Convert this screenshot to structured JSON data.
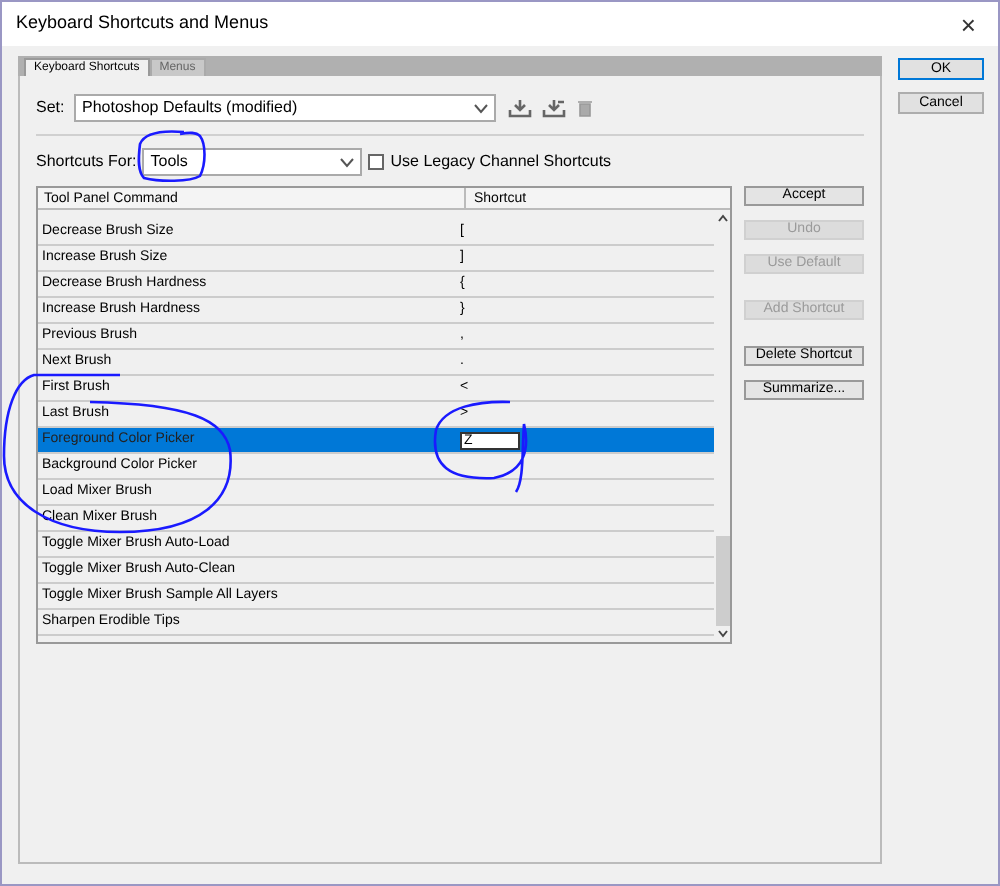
{
  "window": {
    "title": "Keyboard Shortcuts and Menus",
    "close": "×"
  },
  "tabs": [
    {
      "label": "Keyboard Shortcuts",
      "selected": true
    },
    {
      "label": "Menus",
      "selected": false
    }
  ],
  "set": {
    "label": "Set:",
    "value": "Photoshop Defaults (modified)"
  },
  "shortcuts_for": {
    "label": "Shortcuts For:",
    "value": "Tools"
  },
  "legacy": {
    "label": "Use Legacy Channel Shortcuts",
    "checked": false
  },
  "table": {
    "columns": [
      "Tool Panel Command",
      "Shortcut"
    ],
    "rows": [
      {
        "command": "Decrease Brush Size",
        "shortcut": "[",
        "selected": false,
        "kind": "text"
      },
      {
        "command": "Increase Brush Size",
        "shortcut": "]",
        "selected": false,
        "kind": "text"
      },
      {
        "command": "Decrease Brush Hardness",
        "shortcut": "{",
        "selected": false,
        "kind": "text"
      },
      {
        "command": "Increase Brush Hardness",
        "shortcut": "}",
        "selected": false,
        "kind": "text"
      },
      {
        "command": "Previous Brush",
        "shortcut": ",",
        "selected": false,
        "kind": "text"
      },
      {
        "command": "Next Brush",
        "shortcut": ".",
        "selected": false,
        "kind": "text"
      },
      {
        "command": "First Brush",
        "shortcut": "<",
        "selected": false,
        "kind": "text"
      },
      {
        "command": "Last Brush",
        "shortcut": ">",
        "selected": false,
        "kind": "text"
      },
      {
        "command": "Foreground Color Picker",
        "shortcut": "Z",
        "selected": true,
        "kind": "edit"
      },
      {
        "command": "Background Color Picker",
        "selected": false,
        "kind": "text"
      },
      {
        "command": "Load Mixer Brush",
        "selected": false,
        "kind": "text"
      },
      {
        "command": "Clean Mixer Brush",
        "selected": false,
        "kind": "text"
      },
      {
        "command": "Toggle Mixer Brush Auto-Load",
        "selected": false,
        "kind": "text"
      },
      {
        "command": "Toggle Mixer Brush Auto-Clean",
        "selected": false,
        "kind": "text"
      },
      {
        "command": "Toggle Mixer Brush Sample All Layers",
        "selected": false,
        "kind": "text"
      },
      {
        "command": "Sharpen Erodible Tips",
        "selected": false,
        "kind": "text"
      }
    ]
  },
  "side_buttons": [
    {
      "label": "Accept",
      "disabled": false
    },
    {
      "label": "Undo",
      "disabled": true
    },
    {
      "label": "Use Default",
      "disabled": true
    },
    {
      "label": "Add Shortcut",
      "disabled": true
    },
    {
      "label": "Delete Shortcut",
      "disabled": false
    },
    {
      "label": "Summarize...",
      "disabled": false
    }
  ],
  "dialog_buttons": [
    {
      "label": "OK",
      "default": true
    },
    {
      "label": "Cancel",
      "default": false
    }
  ]
}
